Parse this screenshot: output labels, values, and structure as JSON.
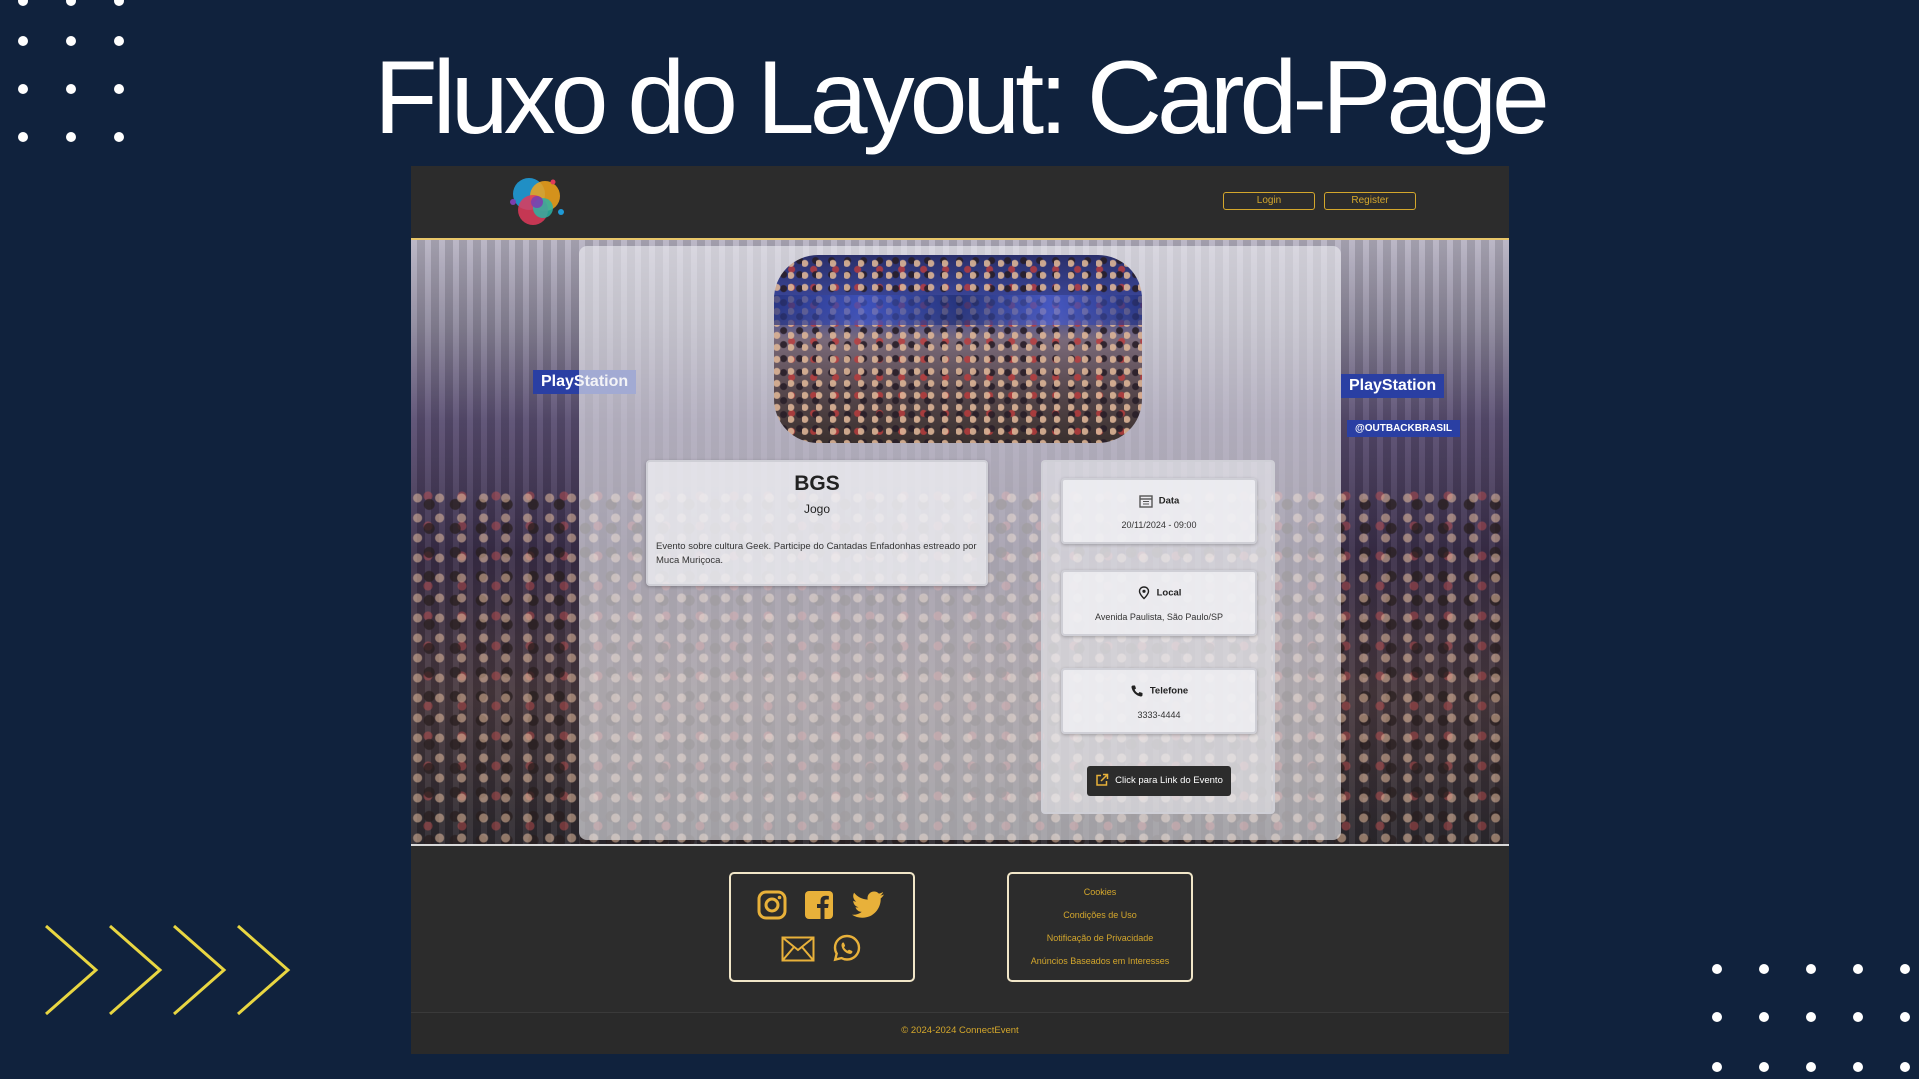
{
  "slide": {
    "title": "Fluxo do Layout: Card-Page",
    "background_color": "#10223d",
    "accent_color": "#e8d642"
  },
  "header": {
    "logo_icon": "multicolor-logo-icon",
    "login_label": "Login",
    "register_label": "Register",
    "button_color": "#d4a72c"
  },
  "event": {
    "name": "BGS",
    "category": "Jogo",
    "description": "Evento sobre cultura Geek. Participe do Cantadas Enfadonhas estreado por Muca Muriçoca.",
    "photo_icon": "event-crowd-photo",
    "details": {
      "date": {
        "title": "Data",
        "value": "20/11/2024 - 09:00",
        "icon": "calendar-icon"
      },
      "location": {
        "title": "Local",
        "value": "Avenida Paulista, São Paulo/SP",
        "icon": "map-pin-icon"
      },
      "phone": {
        "title": "Telefone",
        "value": "3333-4444",
        "icon": "phone-icon"
      }
    },
    "link_label": "Click para Link do Evento",
    "link_icon": "external-link-icon"
  },
  "hero": {
    "signs": [
      "PlayStation",
      "PlayStation",
      "@OUTBACKBRASIL"
    ]
  },
  "footer": {
    "social_icons": [
      "instagram-icon",
      "facebook-icon",
      "twitter-icon",
      "mail-icon",
      "whatsapp-icon"
    ],
    "links": [
      "Cookies",
      "Condições de Uso",
      "Notificação de Privacidade",
      "Anúncios Baseados em Interesses"
    ],
    "copyright": "© 2024-2024 ConnectEvent"
  }
}
